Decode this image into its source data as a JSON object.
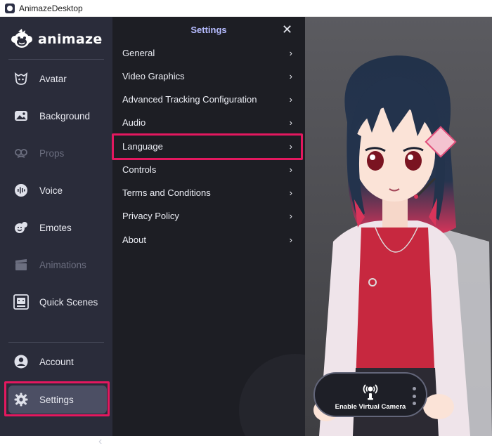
{
  "window": {
    "title": "AnimazeDesktop"
  },
  "sidebar": {
    "brand": "animaze",
    "items": [
      {
        "label": "Avatar",
        "icon": "avatar-icon",
        "state": "normal"
      },
      {
        "label": "Background",
        "icon": "image-icon",
        "state": "normal"
      },
      {
        "label": "Props",
        "icon": "props-glasses-icon",
        "state": "disabled"
      },
      {
        "label": "Voice",
        "icon": "voice-icon",
        "state": "normal"
      },
      {
        "label": "Emotes",
        "icon": "emotes-icon",
        "state": "normal"
      },
      {
        "label": "Animations",
        "icon": "clapperboard-icon",
        "state": "disabled"
      },
      {
        "label": "Quick Scenes",
        "icon": "quick-scenes-icon",
        "state": "normal"
      }
    ],
    "bottom_items": [
      {
        "label": "Account",
        "icon": "user-circle-icon",
        "state": "normal"
      },
      {
        "label": "Settings",
        "icon": "gear-icon",
        "state": "active"
      }
    ],
    "collapse_glyph": "‹"
  },
  "settings_panel": {
    "title": "Settings",
    "close_glyph": "✕",
    "items": [
      {
        "label": "General"
      },
      {
        "label": "Video Graphics"
      },
      {
        "label": "Advanced Tracking Configuration"
      },
      {
        "label": "Audio"
      },
      {
        "label": "Language",
        "highlighted": true
      },
      {
        "label": "Controls"
      },
      {
        "label": "Terms and Conditions"
      },
      {
        "label": "Privacy Policy"
      },
      {
        "label": "About"
      }
    ],
    "chevron_glyph": "›"
  },
  "preview": {
    "virtual_camera_label": "Enable Virtual Camera"
  },
  "colors": {
    "sidebar_bg": "#2a2c3a",
    "panel_bg": "#1d1e24",
    "panel_title": "#b6bcff",
    "highlight": "#e3185f",
    "active_item_bg": "#4c4f64"
  }
}
